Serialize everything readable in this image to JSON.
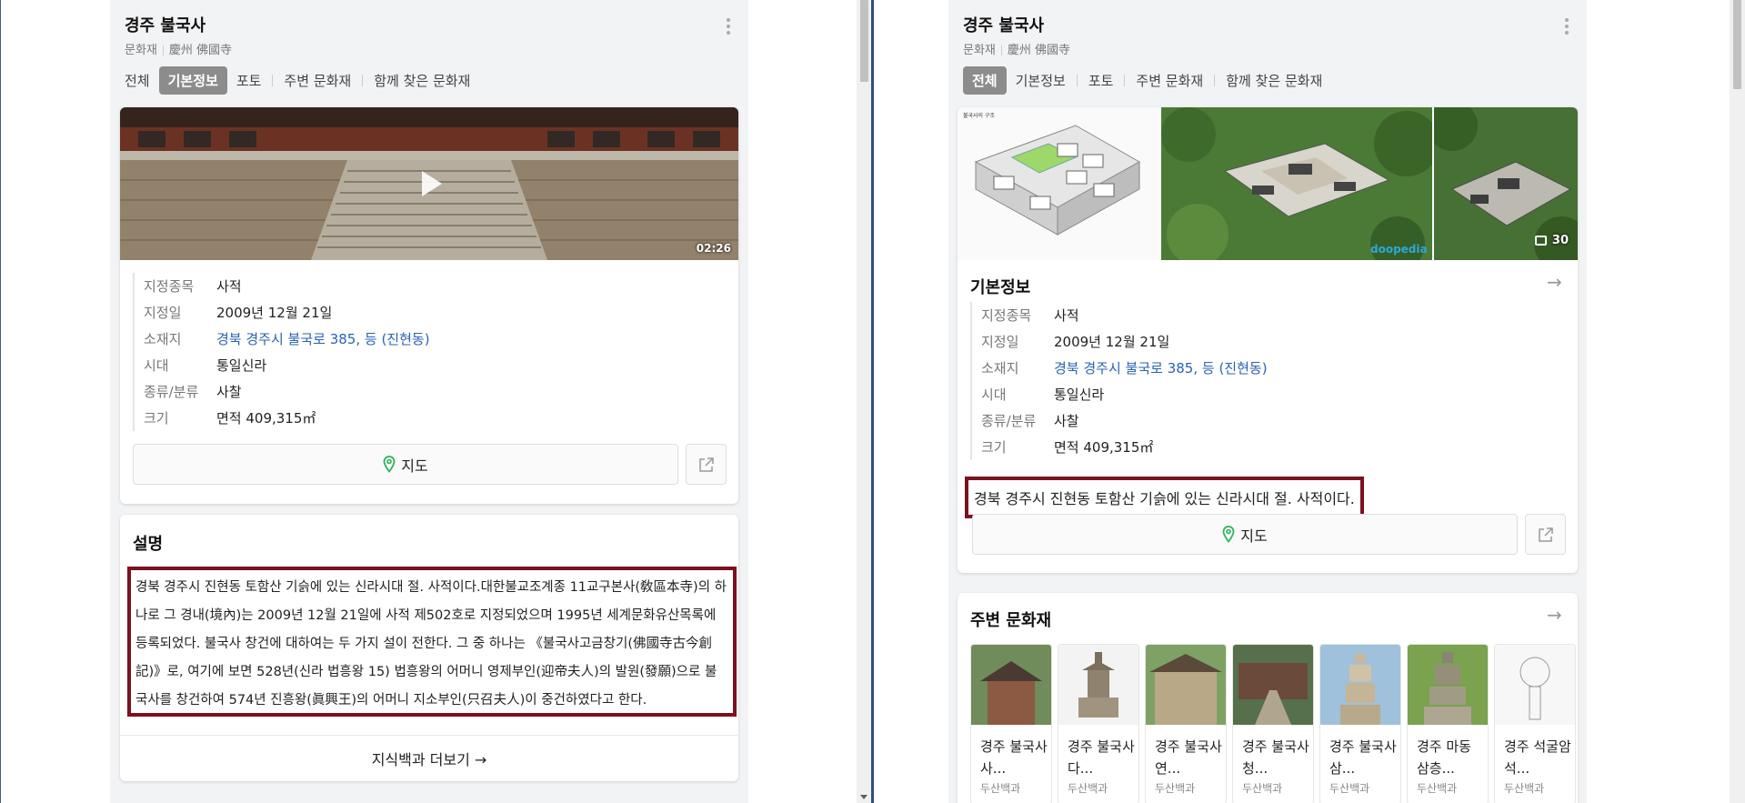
{
  "left": {
    "title": "경주 불국사",
    "subtitle_type": "문화재",
    "subtitle_hanja": "慶州 佛國寺",
    "tabs": [
      "전체",
      "기본정보",
      "포토",
      "주변 문화재",
      "함께 찾은 문화재"
    ],
    "active_tab": "기본정보",
    "video_duration": "02:26",
    "info": [
      {
        "key": "지정종목",
        "value": "사적"
      },
      {
        "key": "지정일",
        "value": "2009년 12월 21일"
      },
      {
        "key": "소재지",
        "value": "경북 경주시 불국로 385, 등 (진현동)"
      },
      {
        "key": "시대",
        "value": "통일신라"
      },
      {
        "key": "종류/분류",
        "value": "사찰"
      },
      {
        "key": "크기",
        "value": "면적 409,315㎡"
      }
    ],
    "map_label": "지도",
    "description_title": "설명",
    "description": "경북 경주시 진현동 토함산 기슭에 있는 신라시대 절. 사적이다.대한불교조계종 11교구본사(敎區本寺)의 하나로 그 경내(境內)는 2009년 12월 21일에 사적 제502호로 지정되었으며 1995년 세계문화유산목록에 등록되었다. 불국사 창건에 대하여는 두 가지 설이 전한다. 그 중 하나는 《불국사고금창기(佛國寺古今創記)》로, 여기에 보면 528년(신라 법흥왕 15) 법흥왕의 어머니 영제부인(迎帝夫人)의 발원(發願)으로 불국사를 창건하여 574년 진흥왕(眞興王)의 어머니 지소부인(只召夫人)이 중건하였다고 한다.",
    "more_label": "지식백과 더보기 →"
  },
  "right": {
    "title": "경주 불국사",
    "subtitle_type": "문화재",
    "subtitle_hanja": "慶州 佛國寺",
    "tabs": [
      "전체",
      "기본정보",
      "포토",
      "주변 문화재",
      "함께 찾은 문화재"
    ],
    "active_tab": "전체",
    "photo_count": "30",
    "diagram_caption": "불국사의 구조",
    "watermark": "doopedia",
    "info_title": "기본정보",
    "info": [
      {
        "key": "지정종목",
        "value": "사적"
      },
      {
        "key": "지정일",
        "value": "2009년 12월 21일"
      },
      {
        "key": "소재지",
        "value": "경북 경주시 불국로 385, 등 (진현동)"
      },
      {
        "key": "시대",
        "value": "통일신라"
      },
      {
        "key": "종류/분류",
        "value": "사찰"
      },
      {
        "key": "크기",
        "value": "면적 409,315㎡"
      }
    ],
    "short_description": "경북 경주시 진현동 토함산 기슭에 있는 신라시대 절. 사적이다.",
    "map_label": "지도",
    "nearby_title": "주변 문화재",
    "nearby": [
      {
        "name": "경주 불국사 사...",
        "source": "두산백과"
      },
      {
        "name": "경주 불국사 다...",
        "source": "두산백과"
      },
      {
        "name": "경주 불국사 연...",
        "source": "두산백과"
      },
      {
        "name": "경주 불국사 청...",
        "source": "두산백과"
      },
      {
        "name": "경주 불국사 삼...",
        "source": "두산백과"
      },
      {
        "name": "경주 마동 삼층...",
        "source": "두산백과"
      },
      {
        "name": "경주 석굴암 석...",
        "source": "두산백과"
      }
    ]
  },
  "colors": {
    "highlight_border": "#7b1120",
    "link": "#2a62b4",
    "active_tab_bg": "#8c8c8c",
    "pin_green": "#2fb45a",
    "divider": "#2d4d86"
  }
}
